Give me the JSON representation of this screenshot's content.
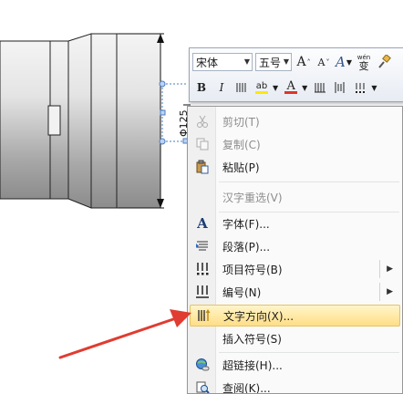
{
  "dimension": {
    "label": "Φ125"
  },
  "mini_toolbar": {
    "font_name": "宋体",
    "font_size": "五号",
    "grow_font": "A",
    "shrink_font": "A",
    "styles": "A",
    "wen": "wén",
    "bian": "变",
    "bold": "B",
    "italic": "I",
    "highlight": "ab",
    "font_color": "A"
  },
  "context_menu": {
    "items": [
      {
        "label": "剪切(T)",
        "disabled": true
      },
      {
        "label": "复制(C)",
        "disabled": true
      },
      {
        "label": "粘贴(P)",
        "disabled": false
      },
      {
        "label": "汉字重选(V)",
        "disabled": true
      },
      {
        "label": "字体(F)...",
        "disabled": false
      },
      {
        "label": "段落(P)...",
        "disabled": false
      },
      {
        "label": "项目符号(B)",
        "disabled": false,
        "submenu": true
      },
      {
        "label": "编号(N)",
        "disabled": false,
        "submenu": true
      },
      {
        "label": "文字方向(X)...",
        "disabled": false,
        "highlighted": true
      },
      {
        "label": "插入符号(S)",
        "disabled": false
      },
      {
        "label": "超链接(H)...",
        "disabled": false
      },
      {
        "label": "查阅(K)...",
        "disabled": false
      }
    ]
  },
  "colors": {
    "highlight_fill": "#ffde86",
    "arrow": "#e03c31",
    "font_color_bar": "#e0342c",
    "highlight_bar": "#ffe800"
  },
  "icons": [
    "scissors-icon",
    "copy-icon",
    "paste-icon",
    "font-icon",
    "paragraph-icon",
    "bullets-icon",
    "numbering-icon",
    "text-direction-icon",
    "hyperlink-icon",
    "lookup-icon",
    "brush-icon"
  ]
}
